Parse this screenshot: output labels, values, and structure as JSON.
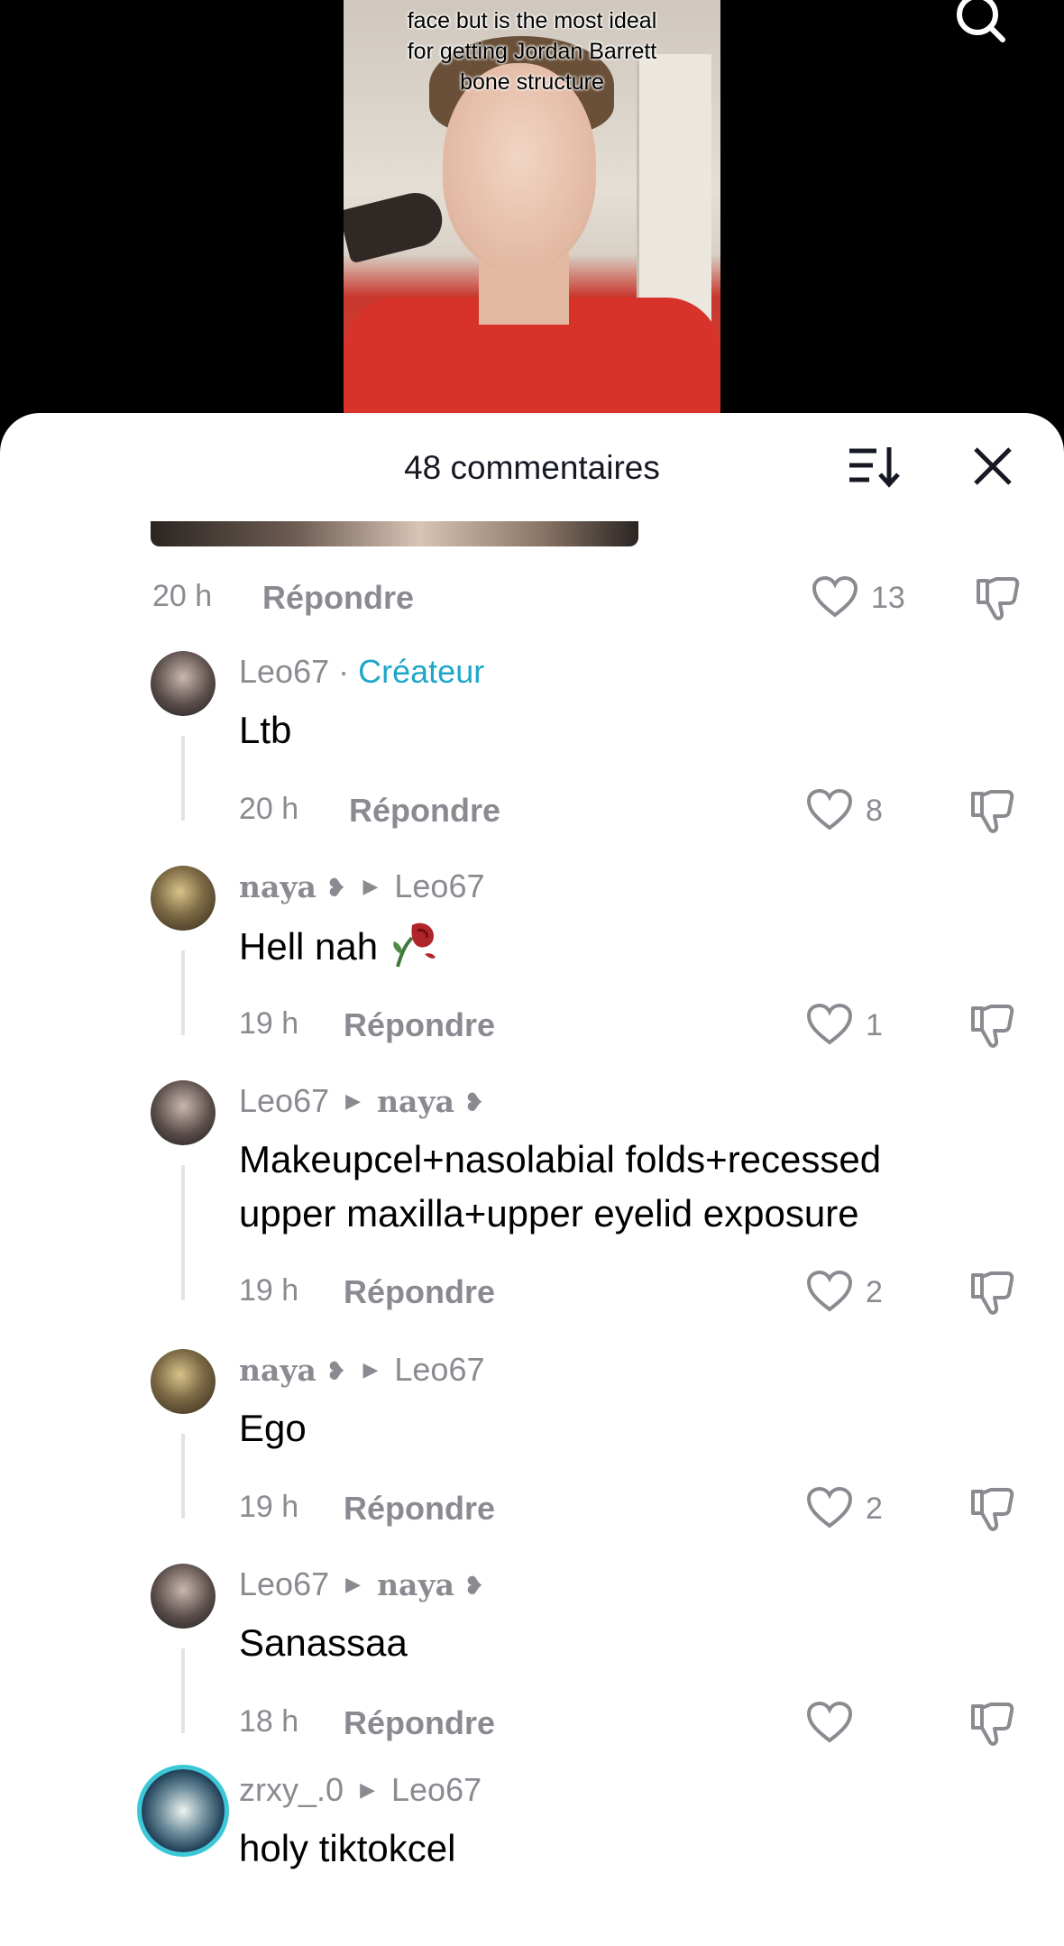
{
  "video": {
    "caption": "face but is the most ideal\nfor getting Jordan Barrett\nbone structure"
  },
  "sheet": {
    "title": "48 commentaires"
  },
  "top_meta": {
    "time": "20 h",
    "reply": "Répondre",
    "likes": "13"
  },
  "comments": [
    {
      "user": "Leo67",
      "separator": "·",
      "badge": "Créateur",
      "text": "Ltb",
      "time": "20 h",
      "reply": "Répondre",
      "likes": "8"
    },
    {
      "user": "naya",
      "target": "Leo67",
      "text": "Hell nah",
      "time": "19 h",
      "reply": "Répondre",
      "likes": "1"
    },
    {
      "user": "Leo67",
      "target": "naya",
      "text": "Makeupcel+nasolabial folds+recessed\nupper maxilla+upper eyelid exposure",
      "time": "19 h",
      "reply": "Répondre",
      "likes": "2"
    },
    {
      "user": "naya",
      "target": "Leo67",
      "text": "Ego",
      "time": "19 h",
      "reply": "Répondre",
      "likes": "2"
    },
    {
      "user": "Leo67",
      "target": "naya",
      "text": "Sanassaa",
      "time": "18 h",
      "reply": "Répondre",
      "likes": ""
    },
    {
      "user": "zrxy_.0",
      "target": "Leo67",
      "text": "holy tiktokcel"
    }
  ],
  "icons": {
    "search": "search-icon",
    "sort": "sort-icon",
    "close": "close-icon",
    "like": "heart-icon",
    "dislike": "thumbs-down-icon"
  },
  "colors": {
    "creator_badge": "#1fa7c9",
    "meta_gray": "#8a8b91",
    "avatar_ring": "#3ac8d9"
  }
}
